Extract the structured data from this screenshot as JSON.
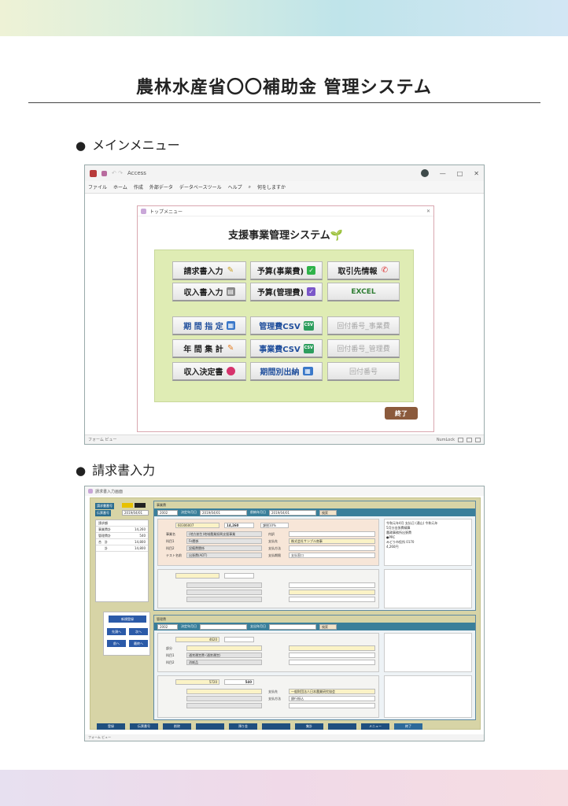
{
  "page": {
    "title": "農林水産省〇〇補助金 管理システム",
    "section1": "メインメニュー",
    "section2": "請求書入力",
    "bullet": "●"
  },
  "colors": {
    "accent_green_panel": "#dfecb4",
    "end_button": "#8b5a3c",
    "button_blue_text": "#1f4e9c",
    "record_bar": "#3a7f9a"
  },
  "window1": {
    "app_title": "Access",
    "menu": [
      "ファイル",
      "ホーム",
      "作成",
      "外部データ",
      "データベースツール",
      "ヘルプ",
      "何をしますか"
    ],
    "status_left": "フォーム ビュー",
    "status_right": "NumLock",
    "form": {
      "title": "トップメニュー",
      "heading": "支援事業管理システム",
      "buttons": {
        "seikyu": "請求書入力",
        "yosan_jigyo": "予算(事業費)",
        "torihiki": "取引先情報",
        "shunyu": "収入書入力",
        "yosan_kanri": "予算(管理費)",
        "excel": "EXCEL",
        "kikan": "期 間 指 定",
        "kanri_csv": "管理費CSV",
        "kaifu_jigyo": "回付番号_事業費",
        "nenkan": "年 間 集 計",
        "jigyo_csv": "事業費CSV",
        "kaifu_kanri": "回付番号_管理費",
        "kettei": "収入決定書",
        "kikanbetsu": "期間別出納",
        "kaifu": "回付番号"
      },
      "end_label": "終了"
    },
    "icons": [
      "leaf-icon",
      "pencil-icon",
      "check-icon",
      "phone-icon",
      "cabinet-icon",
      "calendar-icon",
      "csv-icon",
      "gem-icon"
    ]
  },
  "window2": {
    "title": "請求書入力画面",
    "left": {
      "labels": [
        "請求書番号",
        "伝票番号"
      ],
      "date": "2019/04/01",
      "list_title": "請求額",
      "rows": [
        {
          "k": "事業費計",
          "v": "14,260"
        },
        {
          "k": "管理費計",
          "v": "540"
        },
        {
          "k": "合　計",
          "v": "14,800"
        },
        {
          "k": "　　計",
          "v": "14,800"
        }
      ],
      "nav_title": "新規登録",
      "nav": [
        "先頭へ",
        "次へ",
        "前へ",
        "最終へ"
      ]
    },
    "rec1": {
      "head": "事業費",
      "code": "2002",
      "lbl_date1": "決定年月日",
      "date1": "2019/04/01",
      "lbl_date2": "前納年月日",
      "date2": "2019/04/01",
      "search": "検索",
      "code2": "60306007",
      "amount": "14,260",
      "rate": "課税10%",
      "labels": [
        "事業名",
        "科目1",
        "科目2",
        "テスト名前",
        "内訳",
        "支払方法",
        "支払先",
        "支払期限"
      ],
      "values": [
        "(地方創生)地域農業振興支援事業",
        "Fe関係",
        "設備費関係",
        "出張費(ADT)",
        "",
        "",
        "株式会社サンプル商事",
        "支払窓口"
      ],
      "note": [
        "令和元年4月 支払日 (通山) 令和元年",
        "5月分出張費精算",
        "",
        "農政事務所出張費",
        "●PRC",
        "みどり市役所 0170",
        "4,260円"
      ]
    },
    "rec2": {
      "head": "管理費",
      "code": "2002",
      "lbl_date1": "決定年月日",
      "lbl_date2": "支出年月日",
      "search": "検索",
      "amount1": "4620",
      "amount2": "5720",
      "amount3": "540",
      "labels": [
        "部分",
        "科目1",
        "科目2",
        "支払方法",
        "支払先"
      ],
      "values": [
        "通常運営費",
        "(通常運営)",
        "消耗品",
        "一般財団法人日本農業研究協会",
        "銀行振込"
      ]
    },
    "bottom": [
      "登録",
      "伝票番号",
      "削除",
      "",
      "預り金",
      "",
      "集計",
      "",
      "メニュー",
      "終了"
    ],
    "status": "フォーム ビュー"
  }
}
